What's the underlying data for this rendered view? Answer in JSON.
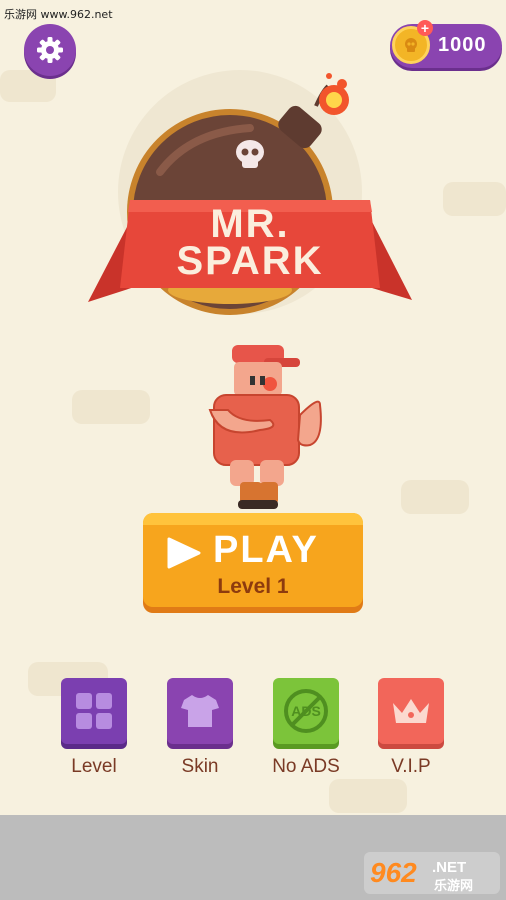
{
  "watermark_top": "乐游网 www.962.net",
  "header": {
    "settings_icon": "gear-icon",
    "coins": "1000",
    "coin_plus": "+"
  },
  "logo": {
    "line1": "MR.",
    "line2": "SPARK"
  },
  "play": {
    "label": "PLAY",
    "level": "Level 1"
  },
  "menu": [
    {
      "label": "Level",
      "icon": "grid-icon",
      "color": "#7b3fb0"
    },
    {
      "label": "Skin",
      "icon": "shirt-icon",
      "color": "#8a44b0"
    },
    {
      "label": "No ADS",
      "icon": "no-ads-icon",
      "color": "#7cc43a"
    },
    {
      "label": "V.I.P",
      "icon": "crown-icon",
      "color": "#f2665a"
    }
  ],
  "watermark_bottom": {
    "text1": "962",
    "text2": ".NET",
    "text3": "乐游网"
  }
}
